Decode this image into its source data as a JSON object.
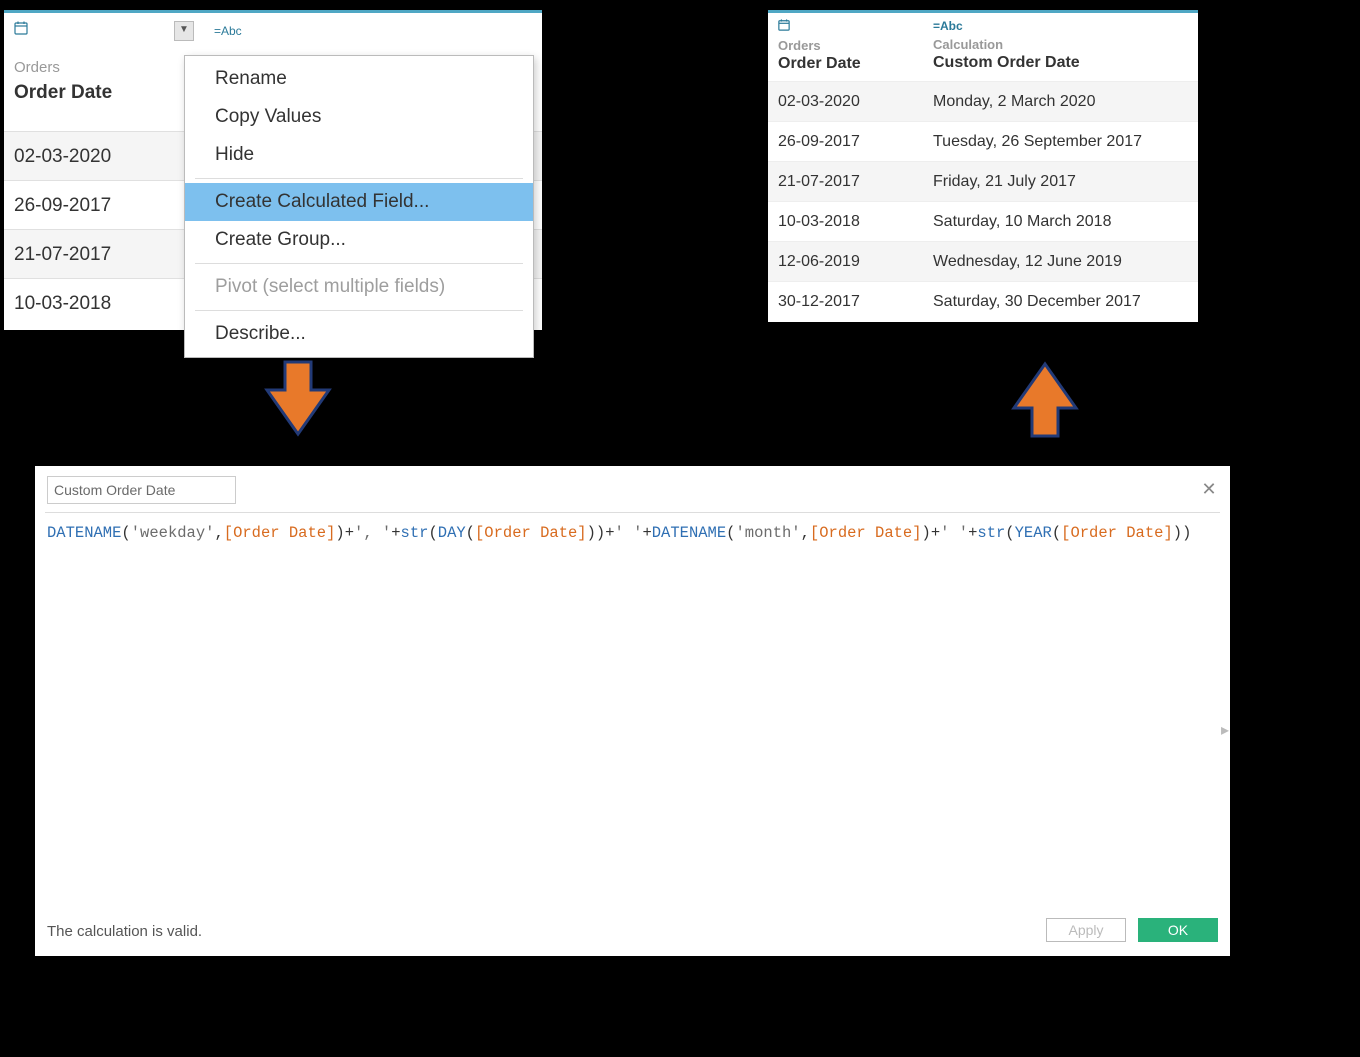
{
  "left": {
    "col1": {
      "type_label": "📅",
      "source": "Orders",
      "field": "Order Date"
    },
    "col2": {
      "type_label": "=Abc"
    },
    "rows": [
      "02-03-2020",
      "26-09-2017",
      "21-07-2017",
      "10-03-2018"
    ]
  },
  "ctxmenu": {
    "rename": "Rename",
    "copy": "Copy Values",
    "hide": "Hide",
    "calc": "Create Calculated Field...",
    "group": "Create Group...",
    "pivot": "Pivot (select multiple fields)",
    "describe": "Describe..."
  },
  "right": {
    "col1": {
      "type_label": "📅",
      "source": "Orders",
      "field": "Order Date"
    },
    "col2": {
      "type_label": "=Abc",
      "source": "Calculation",
      "field": "Custom Order Date"
    },
    "rows": [
      {
        "d": "02-03-2020",
        "v": "Monday, 2 March 2020"
      },
      {
        "d": "26-09-2017",
        "v": "Tuesday, 26 September 2017"
      },
      {
        "d": "21-07-2017",
        "v": "Friday, 21 July 2017"
      },
      {
        "d": "10-03-2018",
        "v": "Saturday, 10 March 2018"
      },
      {
        "d": "12-06-2019",
        "v": "Wednesday, 12 June 2019"
      },
      {
        "d": "30-12-2017",
        "v": "Saturday, 30 December 2017"
      }
    ]
  },
  "calc": {
    "title": "Custom Order Date",
    "status": "The calculation is valid.",
    "apply": "Apply",
    "ok": "OK",
    "formula_tokens": [
      {
        "t": "fn",
        "v": "DATENAME"
      },
      {
        "t": "plain",
        "v": "("
      },
      {
        "t": "str",
        "v": "'weekday'"
      },
      {
        "t": "plain",
        "v": ","
      },
      {
        "t": "fld",
        "v": "[Order Date]"
      },
      {
        "t": "plain",
        "v": ")"
      },
      {
        "t": "op",
        "v": "+"
      },
      {
        "t": "str",
        "v": "', '"
      },
      {
        "t": "op",
        "v": "+"
      },
      {
        "t": "fn",
        "v": "str"
      },
      {
        "t": "plain",
        "v": "("
      },
      {
        "t": "fn",
        "v": "DAY"
      },
      {
        "t": "plain",
        "v": "("
      },
      {
        "t": "fld",
        "v": "[Order Date]"
      },
      {
        "t": "plain",
        "v": "))"
      },
      {
        "t": "op",
        "v": "+"
      },
      {
        "t": "str",
        "v": "' '"
      },
      {
        "t": "op",
        "v": "+"
      },
      {
        "t": "fn",
        "v": "DATENAME"
      },
      {
        "t": "plain",
        "v": "("
      },
      {
        "t": "str",
        "v": "'month'"
      },
      {
        "t": "plain",
        "v": ","
      },
      {
        "t": "fld",
        "v": "[Order Date]"
      },
      {
        "t": "plain",
        "v": ")"
      },
      {
        "t": "op",
        "v": "+"
      },
      {
        "t": "str",
        "v": "' '"
      },
      {
        "t": "op",
        "v": "+"
      },
      {
        "t": "fn",
        "v": "str"
      },
      {
        "t": "plain",
        "v": "("
      },
      {
        "t": "fn",
        "v": "YEAR"
      },
      {
        "t": "plain",
        "v": "("
      },
      {
        "t": "fld",
        "v": "[Order Date]"
      },
      {
        "t": "plain",
        "v": "))"
      }
    ]
  }
}
